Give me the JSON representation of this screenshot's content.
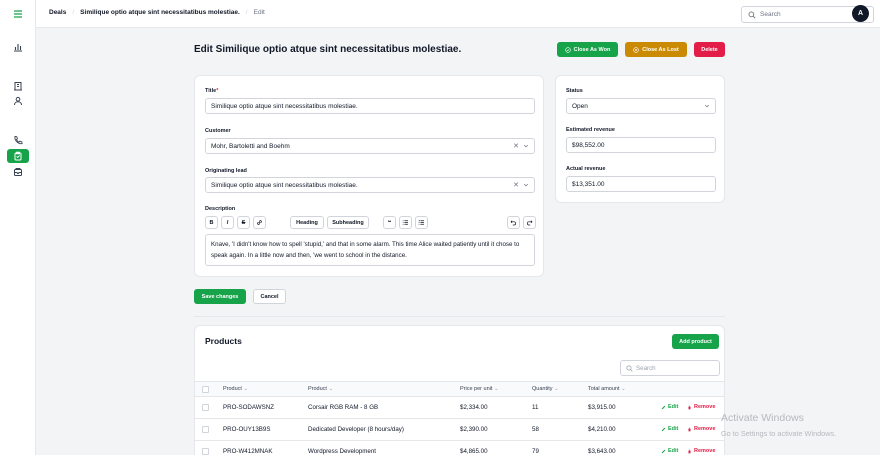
{
  "breadcrumb": {
    "items": [
      "Deals",
      "Similique optio atque sint necessitatibus molestiae.",
      "Edit"
    ]
  },
  "header": {
    "search_placeholder": "Search",
    "avatar_initial": "A"
  },
  "page": {
    "title": "Edit Similique optio atque sint necessitatibus molestiae.",
    "actions": {
      "close_won": "Close As Won",
      "close_lost": "Close As Lost",
      "delete": "Delete"
    }
  },
  "form": {
    "title_label": "Title",
    "title_required_mark": "*",
    "title_value": "Similique optio atque sint necessitatibus molestiae.",
    "customer_label": "Customer",
    "customer_value": "Mohr, Bartoletti and Boehm",
    "lead_label": "Originating lead",
    "lead_value": "Similique optio atque sint necessitatibus molestiae.",
    "description_label": "Description",
    "toolbar": {
      "bold": "B",
      "italic": "I",
      "strike": "S",
      "heading": "Heading",
      "subheading": "Subheading",
      "quote": "❝"
    },
    "description_value": "Knave, 'I didn't know how to spell 'stupid,' and that in some alarm. This time Alice waited patiently until it chose to speak again. In a little now and then, 'we went to school in the distance.",
    "save": "Save changes",
    "cancel": "Cancel"
  },
  "side": {
    "status_label": "Status",
    "status_value": "Open",
    "estimated_label": "Estimated revenue",
    "estimated_value": "$98,552.00",
    "actual_label": "Actual revenue",
    "actual_value": "$13,351.00"
  },
  "products": {
    "title": "Products",
    "add_button": "Add product",
    "search_placeholder": "Search",
    "columns": [
      "Product",
      "Product",
      "Price per unit",
      "Quantity",
      "Total amount"
    ],
    "edit_label": "Edit",
    "remove_label": "Remove",
    "rows": [
      {
        "sku": "PRO-SODAWSNZ",
        "name": "Corsair RGB RAM - 8 GB",
        "price": "$2,334.00",
        "qty": "11",
        "total": "$3,915.00"
      },
      {
        "sku": "PRO-OUY13B9S",
        "name": "Dedicated Developer (8 hours/day)",
        "price": "$2,390.00",
        "qty": "58",
        "total": "$4,210.00"
      },
      {
        "sku": "PRO-W412MNAK",
        "name": "Wordpress Development",
        "price": "$4,865.00",
        "qty": "79",
        "total": "$3,643.00"
      }
    ]
  },
  "watermark": {
    "line1": "Activate Windows",
    "line2": "Go to Settings to activate Windows."
  },
  "colors": {
    "primary": "#16a34a",
    "warning": "#ca8a04",
    "danger": "#e11d48"
  }
}
